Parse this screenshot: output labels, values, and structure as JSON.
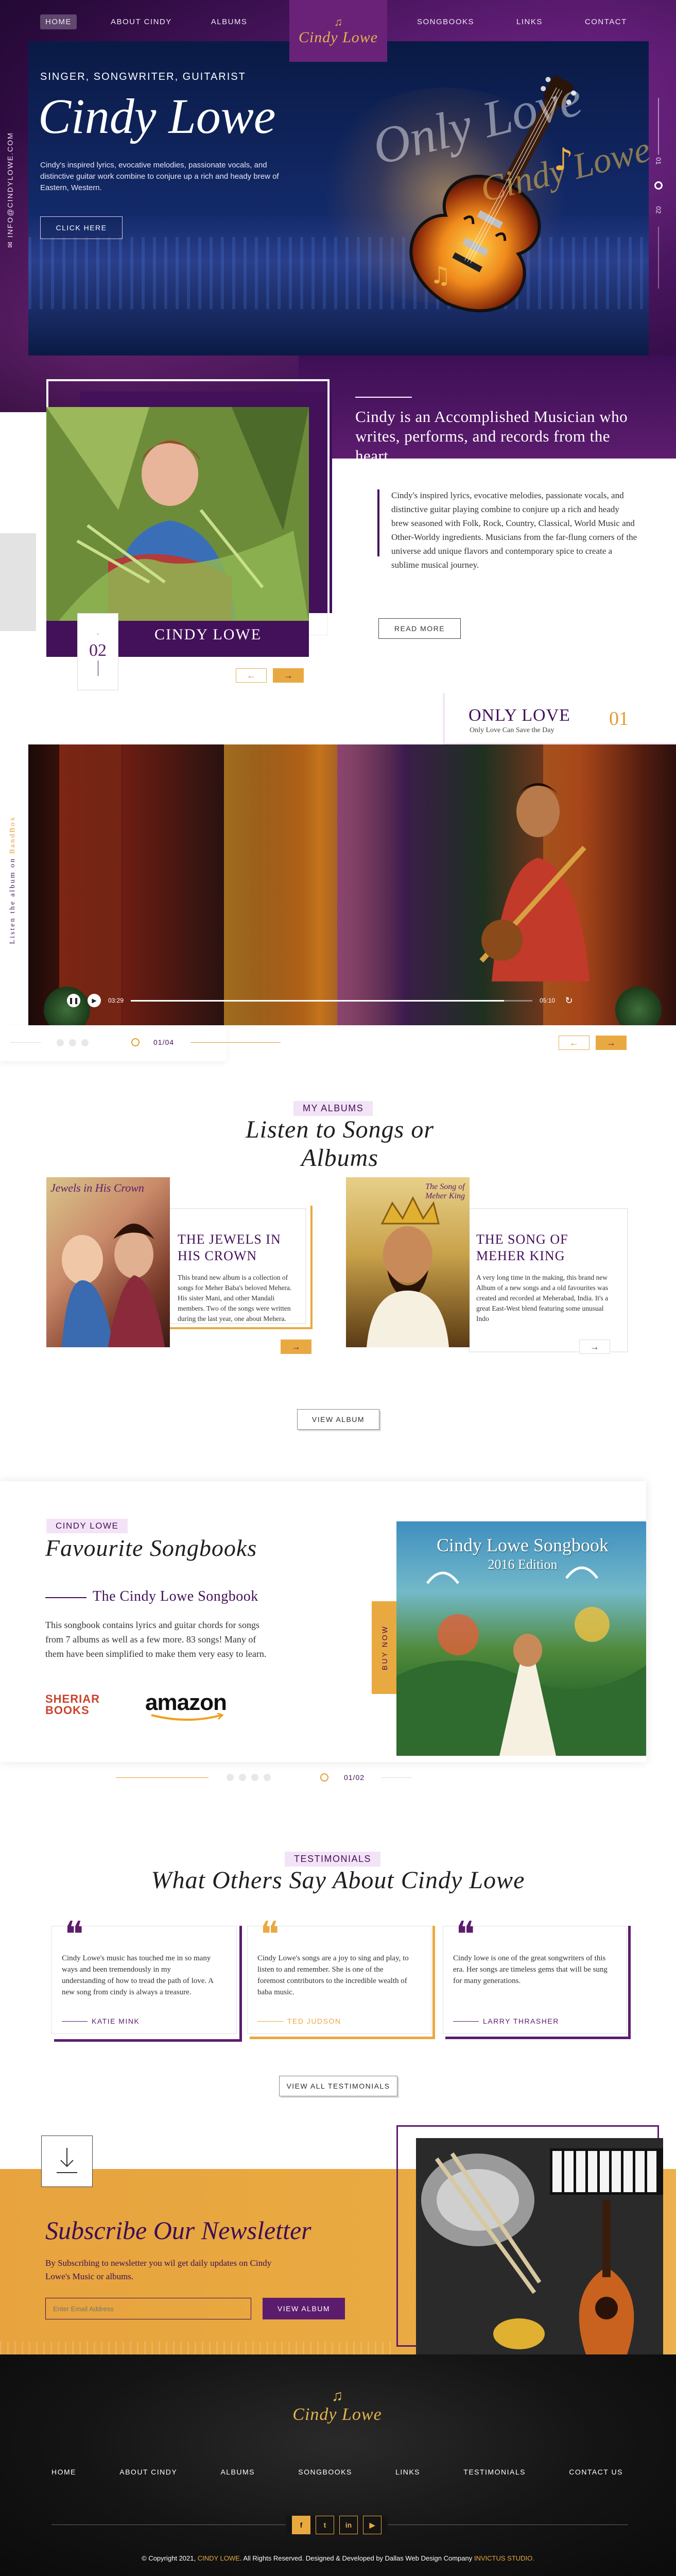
{
  "nav": {
    "left": [
      "HOME",
      "ABOUT CINDY",
      "ALBUMS"
    ],
    "right": [
      "SONGBOOKS",
      "LINKS",
      "CONTACT"
    ],
    "logo": "Cindy Lowe"
  },
  "hero": {
    "subtitle": "SINGER, SONGWRITER, GUITARIST",
    "title": "Cindy Lowe",
    "description": "Cindy's inspired lyrics, evocative melodies, passionate vocals, and distinctive guitar work combine to conjure up a rich and heady brew of Eastern, Western.",
    "cta": "CLICK HERE",
    "side_email": "INFO@CINDYLOWE.COM",
    "counter_current": "01",
    "counter_total": "02"
  },
  "about": {
    "heading": "Cindy is an Accomplished Musician who writes, performs, and records from the heart.",
    "text": "Cindy's inspired lyrics, evocative melodies, passionate vocals, and distinctive guitar playing combine to conjure up a rich and heady brew seasoned with Folk, Rock, Country, Classical, World Music and Other-Worldy ingredients. Musicians from the far-flung corners of the universe add unique flavors and contemporary spice to create a sublime musical journey.",
    "read_more": "READ MORE",
    "photo_label": "CINDY LOWE",
    "counter": "02",
    "prev": "←",
    "next": "→"
  },
  "video": {
    "title": "ONLY LOVE",
    "subtitle": "Only Love Can Save the Day",
    "number": "01",
    "watermark1": "Only Love",
    "watermark2": "Cindy Lowe",
    "side_text_prefix": "Listen the album on",
    "side_text_link": "BandBox",
    "time_current": "03:29",
    "time_total": "05:10",
    "progress": 0.93,
    "pager": "01/04"
  },
  "albums": {
    "tag": "MY ALBUMS",
    "title": "Listen to Songs or Albums",
    "items": [
      {
        "title": "THE JEWELS IN HIS CROWN",
        "cover_text": "Jewels in His Crown",
        "desc": "This brand new album is a collection of songs for Meher Baba's beloved Mehera. His sister Mani, and other Mandali members. Two of the songs were written during the last year, one about Mehera."
      },
      {
        "title": "THE SONG OF MEHER KING",
        "cover_text": "The Song of Meher King",
        "desc": "A very long time in the making, this brand new Album of a new songs and a old favourites was created and recorded at Meherabad, India. It's a great East-West blend featuring some unusual Indo"
      }
    ],
    "view": "VIEW ALBUM"
  },
  "songbooks": {
    "tag": "CINDY LOWE",
    "title": "Favourite Songbooks",
    "subtitle": "The Cindy Lowe Songbook",
    "desc": "This songbook contains lyrics and guitar chords for songs from 7 albums as well as a few more. 83 songs! Many of them have been simplified to make them very easy to learn.",
    "sheriar": "SHERIAR BOOKS",
    "amazon": "amazon",
    "buy_now": "BUY NOW",
    "cover_title": "Cindy Lowe Songbook",
    "cover_edition": "2016 Edition",
    "pager": "01/02"
  },
  "testimonials": {
    "tag": "TESTIMONIALS",
    "title": "What Others Say About Cindy Lowe",
    "items": [
      {
        "text": "Cindy Lowe's music has touched me in so many ways and been tremendously in my understanding of how to tread the path of love. A new song from cindy is always a treasure.",
        "name": "KATIE MINK"
      },
      {
        "text": "Cindy Lowe's songs are a joy to sing and play, to listen to and remember. She is one of the foremost contributors to the incredible wealth of baba music.",
        "name": "TED JUDSON"
      },
      {
        "text": "Cindy lowe is one of the great songwriters of this era. Her songs are timeless gems that will be sung for many generations.",
        "name": "LARRY THRASHER"
      }
    ],
    "view_all": "VIEW ALL TESTIMONIALS"
  },
  "newsletter": {
    "title": "Subscribe Our Newsletter",
    "desc": "By Subscribing to newsletter you wil get daily updates on Cindy Lowe's Music or albums.",
    "placeholder": "Enter Email Address",
    "button": "VIEW ALBUM"
  },
  "footer": {
    "logo": "Cindy Lowe",
    "nav": [
      "HOME",
      "ABOUT CINDY",
      "ALBUMS",
      "SONGBOOKS",
      "LINKS",
      "TESTIMONIALS",
      "CONTACT US"
    ],
    "social": [
      "f",
      "t",
      "in",
      "▶"
    ],
    "copy_prefix": "© Copyright 2021,",
    "copy_brand": "CINDY LOWE",
    "copy_mid": ". All Rights Reserved. Designed & Developed by Dallas Web Design Company",
    "copy_studio": "INVICTUS STUDIO."
  },
  "colors": {
    "purple": "#5c1c6e",
    "deep_purple": "#3d0f55",
    "gold": "#e9a941"
  }
}
